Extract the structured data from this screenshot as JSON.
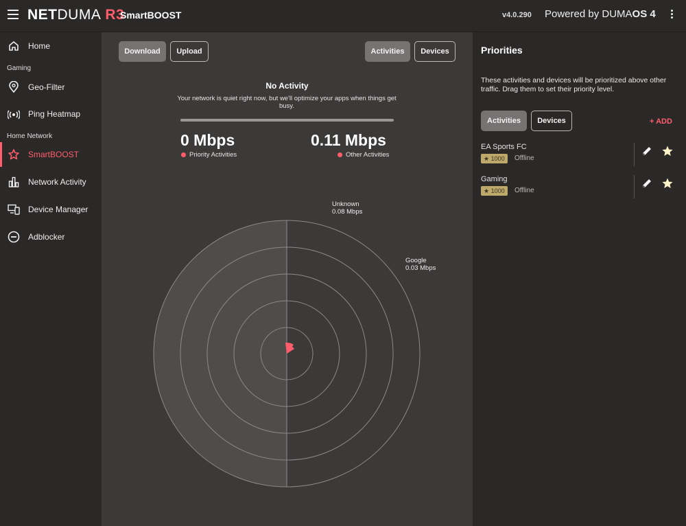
{
  "header": {
    "logo_bold": "NET",
    "logo_thin": "DUMA",
    "logo_model": "R3",
    "page_title": "SmartBOOST",
    "version": "v4.0.290",
    "powered_prefix": "Powered by DUMA",
    "powered_os": "OS 4"
  },
  "sidebar": {
    "items": [
      {
        "label": "Home",
        "icon": "home-icon"
      },
      {
        "section": "Gaming"
      },
      {
        "label": "Geo-Filter",
        "icon": "location-pin-icon"
      },
      {
        "label": "Ping Heatmap",
        "icon": "ping-signal-icon"
      },
      {
        "section": "Home Network"
      },
      {
        "label": "SmartBOOST",
        "icon": "smartboost-icon",
        "active": true
      },
      {
        "label": "Network Activity",
        "icon": "bar-chart-icon"
      },
      {
        "label": "Device Manager",
        "icon": "devices-icon"
      },
      {
        "label": "Adblocker",
        "icon": "block-icon"
      }
    ],
    "home": "Home",
    "section_gaming": "Gaming",
    "geo_filter": "Geo-Filter",
    "ping_heatmap": "Ping Heatmap",
    "section_home_network": "Home Network",
    "smartboost": "SmartBOOST",
    "network_activity": "Network Activity",
    "device_manager": "Device Manager",
    "adblocker": "Adblocker"
  },
  "main": {
    "download_label": "Download",
    "upload_label": "Upload",
    "activities_label": "Activities",
    "devices_label": "Devices",
    "status_title": "No Activity",
    "status_text": "Your network is quiet right now, but we'll optimize your apps when things get busy.",
    "priority_value": "0 Mbps",
    "priority_label": "Priority Activities",
    "other_value": "0.11 Mbps",
    "other_label": "Other Activities",
    "radar": {
      "rings": 5,
      "labels": [
        {
          "name": "Unknown",
          "value": "0.08 Mbps"
        },
        {
          "name": "Google",
          "value": "0.03 Mbps"
        }
      ]
    }
  },
  "priorities": {
    "title": "Priorities",
    "description": "These activities and devices will be prioritized above other traffic. Drag them to set their priority level.",
    "activities_tab": "Activities",
    "devices_tab": "Devices",
    "add_label": "+ ADD",
    "items": [
      {
        "name": "EA Sports FC",
        "score": "★ 1000",
        "status": "Offline"
      },
      {
        "name": "Gaming",
        "score": "★ 1000",
        "status": "Offline"
      }
    ]
  },
  "colors": {
    "accent": "#ff5d6c",
    "panel_bg": "#2b2828",
    "main_bg": "#3c3939",
    "badge": "#bfa96a"
  }
}
